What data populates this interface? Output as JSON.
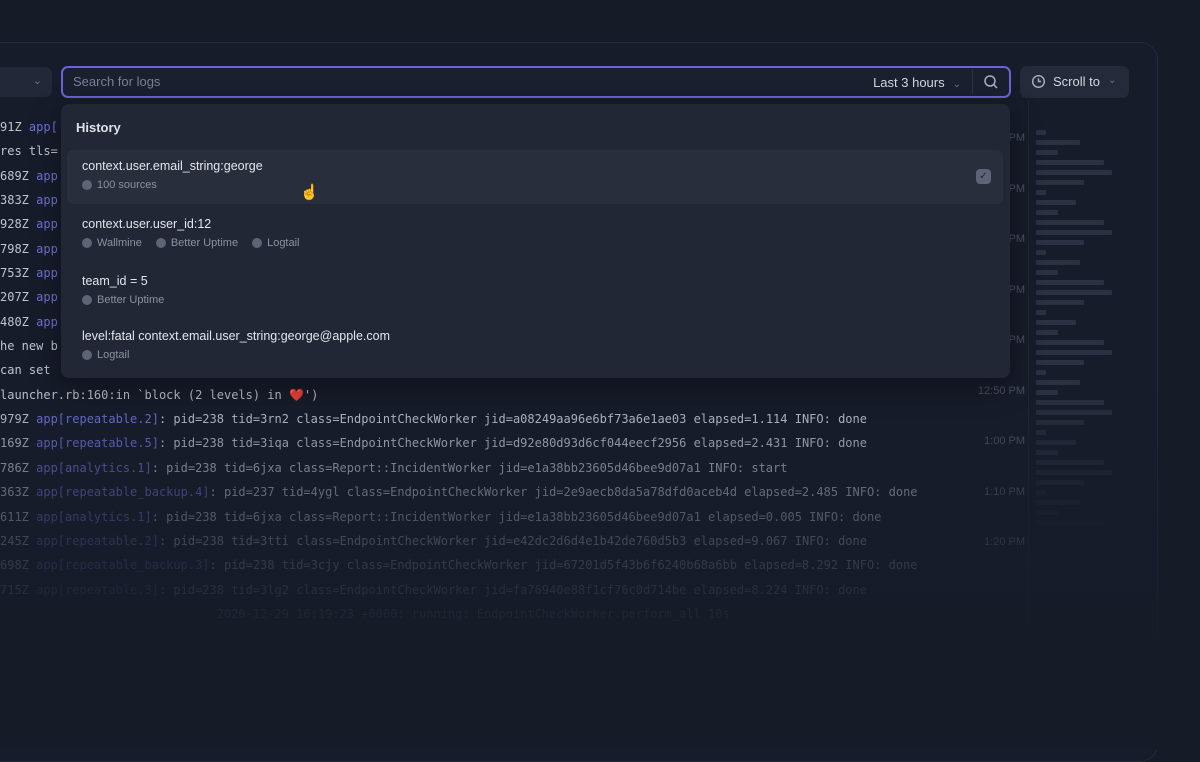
{
  "search": {
    "placeholder": "Search for logs",
    "time_range": "Last 3 hours"
  },
  "scroll_to": {
    "label": "Scroll to"
  },
  "history": {
    "title": "History",
    "items": [
      {
        "query": "context.user.email_string:george",
        "sources": [
          "100 sources"
        ]
      },
      {
        "query": "context.user.user_id:12",
        "sources": [
          "Wallmine",
          "Better Uptime",
          "Logtail"
        ]
      },
      {
        "query": "team_id = 5",
        "sources": [
          "Better Uptime"
        ]
      },
      {
        "query": "level:fatal context.email.user_string:george@apple.com",
        "sources": [
          "Logtail"
        ]
      }
    ]
  },
  "logs": [
    {
      "ts": "91Z ",
      "app": "app[",
      "msg": ""
    },
    {
      "ts": "res tls=",
      "app": "",
      "msg": ""
    },
    {
      "ts": "689Z ",
      "app": "app",
      "msg": ""
    },
    {
      "ts": "383Z ",
      "app": "app",
      "msg": ""
    },
    {
      "ts": "928Z ",
      "app": "app",
      "msg": ""
    },
    {
      "ts": "798Z ",
      "app": "app",
      "msg": ""
    },
    {
      "ts": "753Z ",
      "app": "app",
      "msg": ""
    },
    {
      "ts": "207Z ",
      "app": "app",
      "msg": ""
    },
    {
      "ts": "480Z ",
      "app": "app",
      "msg": ""
    },
    {
      "ts": "he new b",
      "app": "",
      "msg": ""
    },
    {
      "ts": "can set",
      "app": "",
      "msg": ""
    },
    {
      "ts": "launcher.rb:160:in `block (2 levels) in ❤️')",
      "app": "",
      "msg": ""
    },
    {
      "ts": "979Z ",
      "app": "app[repeatable.2]",
      "msg": ": pid=238 tid=3rn2 class=EndpointCheckWorker jid=a08249aa96e6bf73a6e1ae03 elapsed=1.114 INFO: done"
    },
    {
      "ts": "169Z ",
      "app": "app[repeatable.5]",
      "msg": ": pid=238 tid=3iqa class=EndpointCheckWorker jid=d92e80d93d6cf044eecf2956 elapsed=2.431 INFO: done"
    },
    {
      "ts": "786Z ",
      "app": "app[analytics.1]",
      "msg": ": pid=238 tid=6jxa class=Report::IncidentWorker jid=e1a38bb23605d46bee9d07a1 INFO: start"
    },
    {
      "ts": "363Z ",
      "app": "app[repeatable_backup.4]",
      "msg": ": pid=237 tid=4ygl class=EndpointCheckWorker jid=2e9aecb8da5a78dfd0aceb4d elapsed=2.485 INFO: done"
    },
    {
      "ts": "611Z ",
      "app": "app[analytics.1]",
      "msg": ": pid=238 tid=6jxa class=Report::IncidentWorker jid=e1a38bb23605d46bee9d07a1 elapsed=0.005 INFO: done"
    },
    {
      "ts": "245Z ",
      "app": "app[repeatable.2]",
      "msg": ": pid=238 tid=3tti class=EndpointCheckWorker jid=e42dc2d6d4e1b42de760d5b3 elapsed=9.067 INFO: done"
    },
    {
      "ts": "698Z ",
      "app": "app[repeatable_backup.3]",
      "msg": ": pid=238 tid=3cjy class=EndpointCheckWorker jid=67201d5f43b6f6240b68a6bb elapsed=8.292 INFO: done"
    },
    {
      "ts": "715Z ",
      "app": "app[repeatable.3]",
      "msg": ": pid=238 tid=3lg2 class=EndpointCheckWorker jid=fa76940e88f1cf76c0d714be elapsed=8.224 INFO: done"
    },
    {
      "ts": "",
      "app": "",
      "msg": "                              2020-12-29 16:19:23 +0000: running: EndpointCheckWorker.perform_all 10s"
    }
  ],
  "times": [
    "PM",
    "PM",
    "PM",
    "PM",
    "PM",
    "12:50 PM",
    "1:00 PM",
    "1:10 PM",
    "1:20 PM"
  ]
}
